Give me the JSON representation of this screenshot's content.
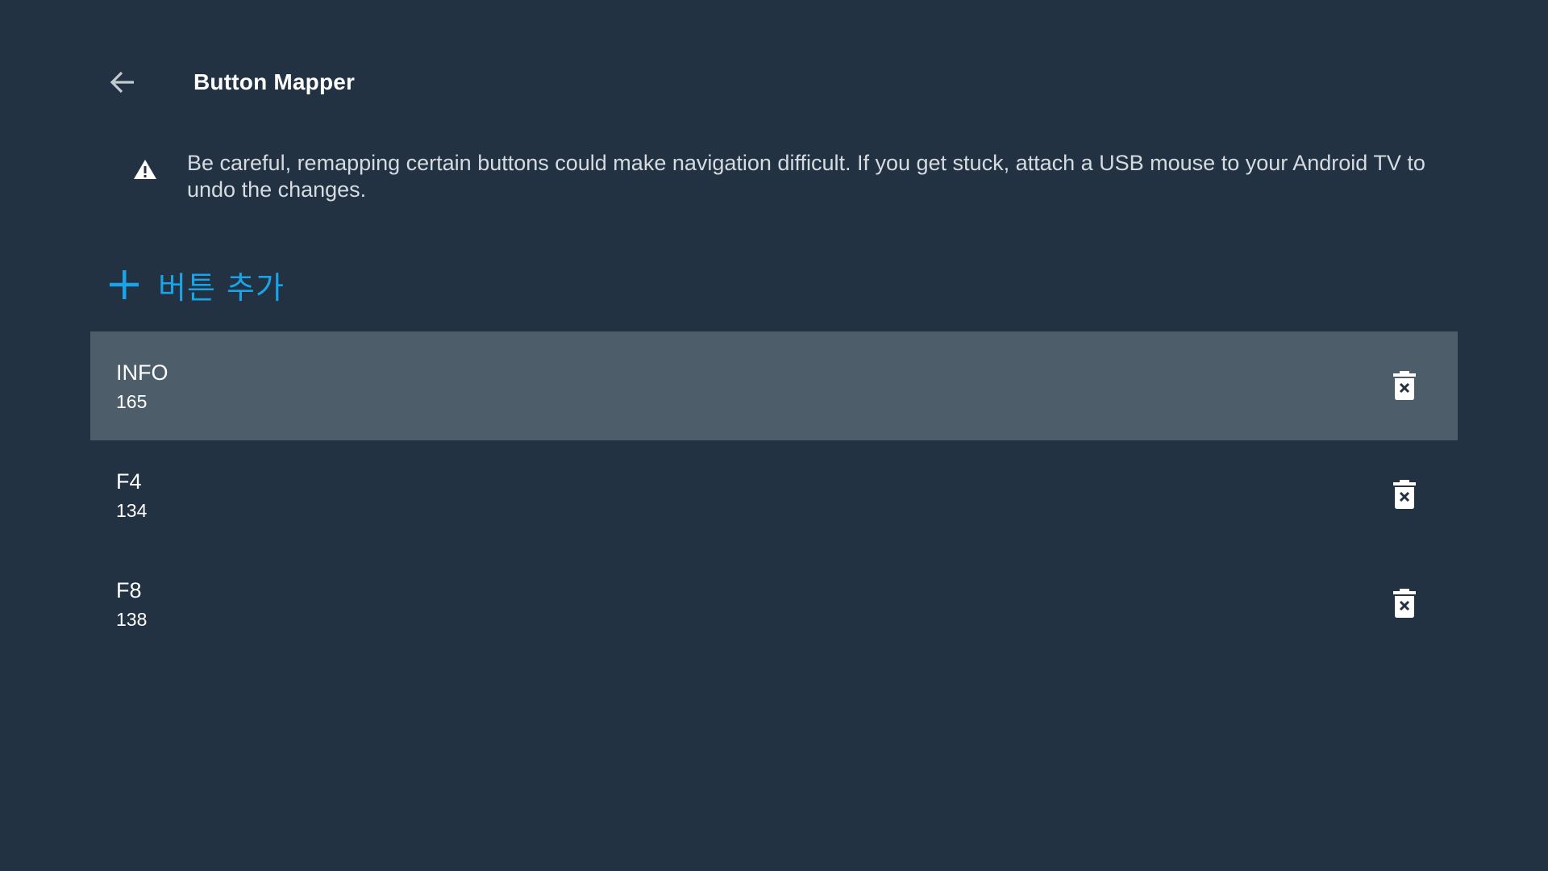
{
  "header": {
    "title": "Button Mapper",
    "back_icon": "arrow-left-icon"
  },
  "warning": {
    "icon": "warning-triangle-icon",
    "text": "Be careful, remapping certain buttons could make navigation difficult. If you get stuck, attach a USB mouse to your Android TV to undo the changes."
  },
  "add_button": {
    "icon": "plus-icon",
    "label": "버튼 추가",
    "color": "#1aa3e6"
  },
  "buttons": [
    {
      "name": "INFO",
      "code": "165",
      "focused": true,
      "delete_icon": "trash-x-icon"
    },
    {
      "name": "F4",
      "code": "134",
      "focused": false,
      "delete_icon": "trash-x-icon"
    },
    {
      "name": "F8",
      "code": "138",
      "focused": false,
      "delete_icon": "trash-x-icon"
    }
  ],
  "colors": {
    "background": "#223242",
    "focused_row": "#4d5d69",
    "accent": "#1aa3e6"
  }
}
